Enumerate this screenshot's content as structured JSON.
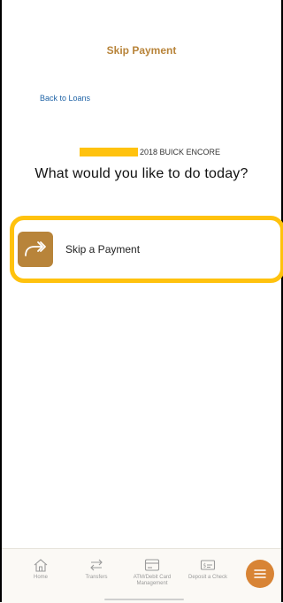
{
  "header": {
    "title": "Skip Payment",
    "back_label": "Back to Loans"
  },
  "account": {
    "name": "2018 BUICK ENCORE"
  },
  "prompt": {
    "question": "What would you like to do today?"
  },
  "options": [
    {
      "label": "Skip a Payment",
      "icon": "skip-arrow-icon"
    }
  ],
  "nav": {
    "items": [
      {
        "label": "Home",
        "icon": "home-icon"
      },
      {
        "label": "Transfers",
        "icon": "transfer-icon"
      },
      {
        "label": "ATM/Debit Card Management",
        "icon": "card-icon"
      },
      {
        "label": "Deposit a Check",
        "icon": "check-icon"
      }
    ],
    "menu_icon": "hamburger-icon"
  },
  "colors": {
    "accent": "#b8843a",
    "link": "#1f63a6",
    "highlight": "#ffc20e",
    "fab": "#d88435"
  }
}
